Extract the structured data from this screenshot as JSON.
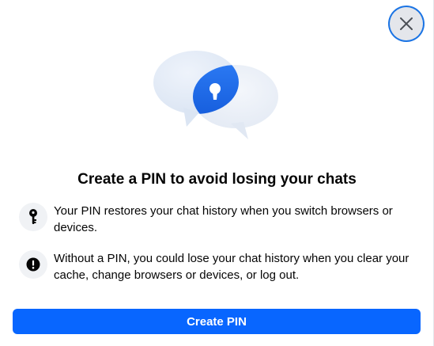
{
  "dialog": {
    "title": "Create a PIN to avoid losing your chats",
    "close_icon": "close-icon",
    "hero_icon": "chat-bubbles-lock-icon",
    "info_items": [
      {
        "icon": "key-icon",
        "text": "Your PIN restores your chat history when you switch browsers or devices."
      },
      {
        "icon": "alert-icon",
        "text": "Without a PIN, you could lose your chat history when you clear your cache, change browsers or devices, or log out."
      }
    ],
    "primary_button_label": "Create PIN"
  },
  "colors": {
    "accent": "#0866ff",
    "close_ring": "#1b74e4",
    "icon_bg": "#f0f2f5",
    "text": "#050505"
  }
}
